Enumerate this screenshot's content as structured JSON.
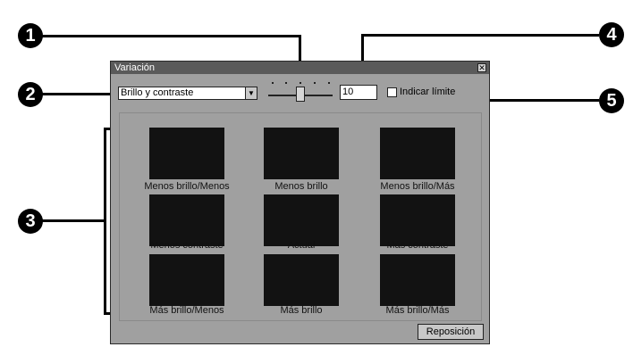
{
  "window": {
    "title": "Variación",
    "close_glyph": "✕"
  },
  "controls": {
    "mode_select": {
      "value": "Brillo y contraste"
    },
    "step_value": "10",
    "limit_checkbox": {
      "label": "Indicar límite",
      "checked": false
    }
  },
  "variations": [
    {
      "label": "Menos brillo/Menos"
    },
    {
      "label": "Menos brillo"
    },
    {
      "label": "Menos brillo/Más"
    },
    {
      "label": "Menos contraste"
    },
    {
      "label": "Actual"
    },
    {
      "label": "Más contraste"
    },
    {
      "label": "Más brillo/Menos"
    },
    {
      "label": "Más brillo"
    },
    {
      "label": "Más brillo/Más"
    }
  ],
  "reset_button": {
    "label": "Reposición"
  },
  "callouts": [
    "1",
    "2",
    "3",
    "4",
    "5"
  ]
}
